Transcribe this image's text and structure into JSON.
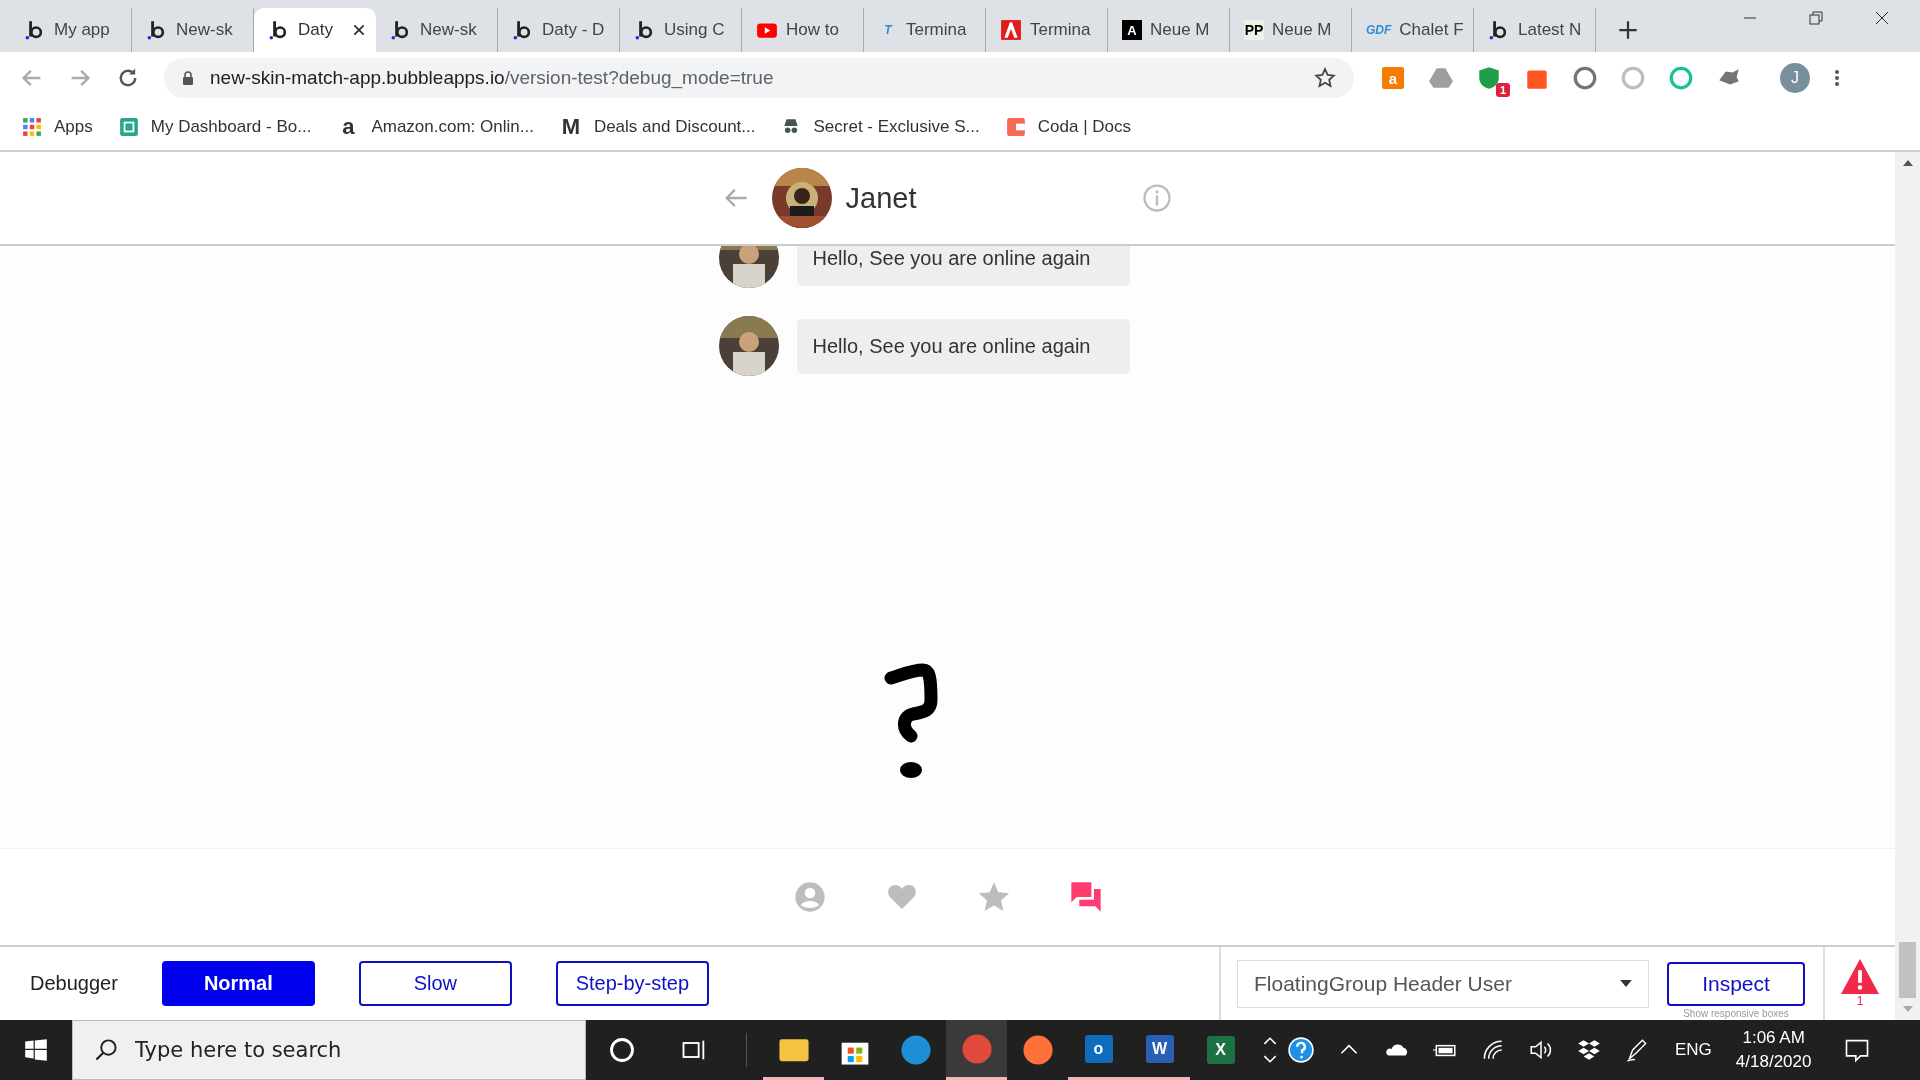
{
  "tabs": [
    {
      "title": "My app",
      "kind": "bubble",
      "selected": false
    },
    {
      "title": "New-sk",
      "kind": "bubble",
      "selected": false
    },
    {
      "title": "Daty",
      "kind": "bubble",
      "selected": true
    },
    {
      "title": "New-sk",
      "kind": "bubble",
      "selected": false
    },
    {
      "title": "Daty - D",
      "kind": "bubble",
      "selected": false
    },
    {
      "title": "Using C",
      "kind": "bubble",
      "selected": false
    },
    {
      "title": "How to",
      "kind": "video",
      "selected": false
    },
    {
      "title": "Termina",
      "kind": "letter",
      "badge": "T",
      "selected": false
    },
    {
      "title": "Termina",
      "kind": "adobe",
      "selected": false
    },
    {
      "title": "Neue M",
      "kind": "block",
      "badge": "A",
      "selected": false
    },
    {
      "title": "Neue M",
      "kind": "block-light",
      "badge": "PP",
      "selected": false
    },
    {
      "title": "Chalet F",
      "kind": "letter",
      "badge": "GDF",
      "selected": false
    },
    {
      "title": "Latest N",
      "kind": "bubble",
      "selected": false
    }
  ],
  "address": {
    "host": "new-skin-match-app.bubbleapps.io",
    "path": "/version-test?debug_mode=true"
  },
  "extensions": [
    {
      "kind": "bag",
      "text": "a"
    },
    {
      "kind": "drive"
    },
    {
      "kind": "shield",
      "badge": "1"
    },
    {
      "kind": "tag"
    },
    {
      "kind": "check"
    },
    {
      "kind": "ring"
    },
    {
      "kind": "grammar"
    },
    {
      "kind": "puzzle"
    }
  ],
  "profile": "J",
  "bookmarks": [
    {
      "label": "Apps",
      "kind": "grid"
    },
    {
      "label": "My Dashboard - Bo...",
      "kind": "dashboard"
    },
    {
      "label": "Amazon.com: Onlin...",
      "kind": "letter",
      "icon_text": "a"
    },
    {
      "label": "Deals and Discount...",
      "kind": "letter",
      "icon_text": "M"
    },
    {
      "label": "Secret - Exclusive S...",
      "kind": "spy"
    },
    {
      "label": "Coda | Docs",
      "kind": "coda"
    }
  ],
  "chat": {
    "name": "Janet",
    "messages": [
      "Hello, See you are online again",
      "Hello, See you are online again"
    ]
  },
  "nav": [
    {
      "kind": "profile",
      "selected": false
    },
    {
      "kind": "heart",
      "selected": false
    },
    {
      "kind": "star",
      "selected": false
    },
    {
      "kind": "chat",
      "selected": true
    }
  ],
  "debugger": {
    "label": "Debugger",
    "speeds": [
      {
        "label": "Normal",
        "selected": true
      },
      {
        "label": "Slow",
        "selected": false
      },
      {
        "label": "Step-by-step",
        "selected": false
      }
    ],
    "element": "FloatingGroup Header User",
    "inspect": "Inspect",
    "hint": "Show responsive boxes",
    "warnings": "1"
  },
  "taskbar": {
    "search_placeholder": "Type here to search",
    "apps": [
      {
        "kind": "explorer",
        "open": true
      },
      {
        "kind": "store",
        "open": false
      },
      {
        "kind": "edge",
        "open": false
      },
      {
        "kind": "chrome",
        "open": true,
        "active": true
      },
      {
        "kind": "firefox",
        "open": false
      },
      {
        "kind": "outlook",
        "letter": "o",
        "open": true
      },
      {
        "kind": "word",
        "letter": "W",
        "open": true
      },
      {
        "kind": "excel",
        "letter": "X",
        "open": false
      }
    ],
    "language": "ENG",
    "time": "1:06 AM",
    "date": "4/18/2020"
  }
}
